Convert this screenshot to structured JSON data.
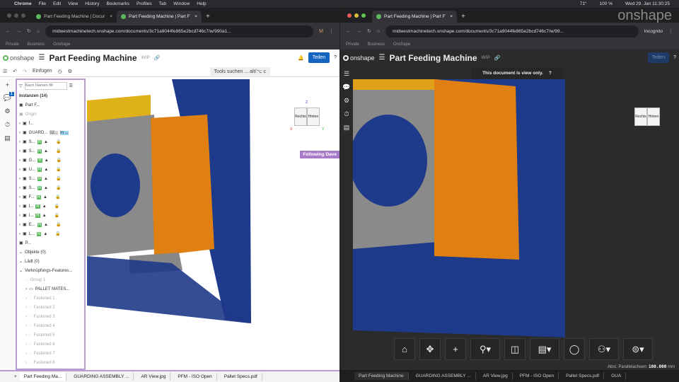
{
  "menubar": {
    "app": "Chrome",
    "items": [
      "File",
      "Edit",
      "View",
      "History",
      "Bookmarks",
      "Profiles",
      "Tab",
      "Window",
      "Help"
    ],
    "battery": "100 %",
    "temp": "71°",
    "datetime": "Wed 29. Jan  11:30:25"
  },
  "left": {
    "tabs": [
      "Part Feeding Machine | Docur",
      "Part Feeding Machine | Part F"
    ],
    "url": "midwestmachinetech.onshape.com/documents/3c71a9044fe865e2bcd746c7/w/990a1...",
    "profile": "M",
    "bookmarks": [
      "Private",
      "Business",
      "Onshape"
    ],
    "logo": "onshape",
    "doc_title": "Part Feeding Machine",
    "wip": "WIP",
    "share": "Teilen",
    "toolbar": {
      "insert": "Einfügen",
      "search": "Tools suchen ...",
      "shortcut": "alt/⌥ c"
    },
    "filter_placeholder": "Nach Namen filt",
    "instances": "Instanzen (14)",
    "badge": "1",
    "tree": [
      "Part F...",
      "Origin",
      "f...",
      "GUARD...",
      "S...",
      "S...",
      "G...",
      "U...",
      "S...",
      "S...",
      "F...",
      "I...",
      "I...",
      "E...",
      "L...",
      "P..."
    ],
    "guard_tags": [
      "02...",
      "In ..."
    ],
    "sections": [
      "Objekte (0)",
      "Lädt (0)",
      "Verknüpfungs-Features..."
    ],
    "mates": [
      "Group 1",
      "PALLET MATES...",
      "Fastened 1",
      "Fastened 2",
      "Fastened 3",
      "Fastened 4",
      "Fastened 5",
      "Fastened 6",
      "Fastened 7",
      "Fastened 8"
    ],
    "following": "Following Dave",
    "cube": {
      "z": "Z",
      "x": "X",
      "y": "Y",
      "front": "Rechts",
      "side": "Hinten"
    },
    "bottom_tabs": [
      "Part Feeding Ma...",
      "GUARDING ASSEMBLY ...",
      "AR View.jpg",
      "PFM - ISO Open",
      "Pallet Specs.pdf"
    ]
  },
  "right": {
    "tab": "Part Feeding Machine | Part F",
    "url": "midwestmachinetech.onshape.com/documents/3c71a9044fe865e2bcd746c7/w/99...",
    "incognito": "Incognito",
    "bookmarks": [
      "Private",
      "Business",
      "Onshape"
    ],
    "logo": "onshape",
    "doc_title": "Part Feeding Machine",
    "wip": "WIP",
    "share": "Teilen",
    "banner": "This document is view only.",
    "cube": {
      "front": "Rechts",
      "side": "Hinten"
    },
    "status_label": "Abst. Parallelachsen:",
    "status_value": "100.000",
    "status_unit": "mm",
    "bottom_tabs": [
      "Part Feeding Machine",
      "GUARDING ASSEMBLY ...",
      "AR View.jpg",
      "PFM - ISO Open",
      "Pallet Specs.pdf",
      "GUA"
    ]
  },
  "watermark": "onshape"
}
